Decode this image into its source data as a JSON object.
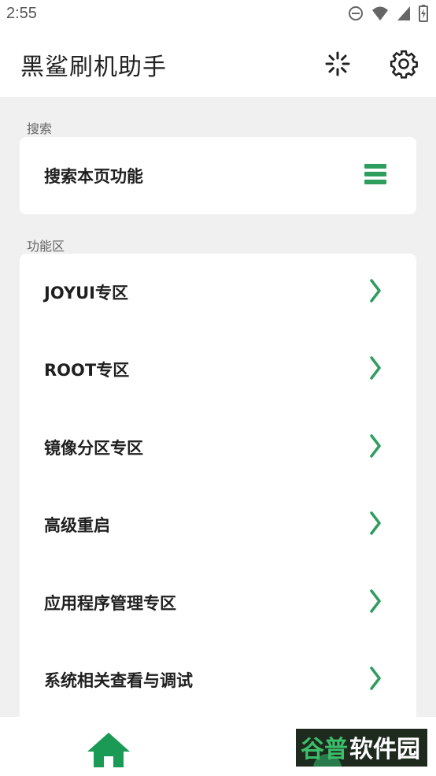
{
  "status_bar": {
    "time": "2:55",
    "icons": [
      "do-not-disturb-icon",
      "wifi-icon",
      "signal-icon",
      "battery-charging-icon"
    ]
  },
  "app_bar": {
    "title": "黑鲨刷机助手",
    "actions": [
      "loading-icon",
      "settings-icon"
    ]
  },
  "search_section": {
    "label": "搜索",
    "item": {
      "label": "搜索本页功能",
      "icon": "menu-icon"
    }
  },
  "function_section": {
    "label": "功能区",
    "items": [
      {
        "label": "JOYUI专区"
      },
      {
        "label": "ROOT专区"
      },
      {
        "label": "镜像分区专区"
      },
      {
        "label": "高级重启"
      },
      {
        "label": "应用程序管理专区"
      },
      {
        "label": "系统相关查看与调试"
      }
    ]
  },
  "bottom_nav": {
    "items": [
      "home-icon"
    ]
  },
  "watermark": {
    "text": "谷普软件园"
  },
  "colors": {
    "accent": "#2e9e5f",
    "background": "#f0f0f0",
    "card": "#ffffff"
  }
}
